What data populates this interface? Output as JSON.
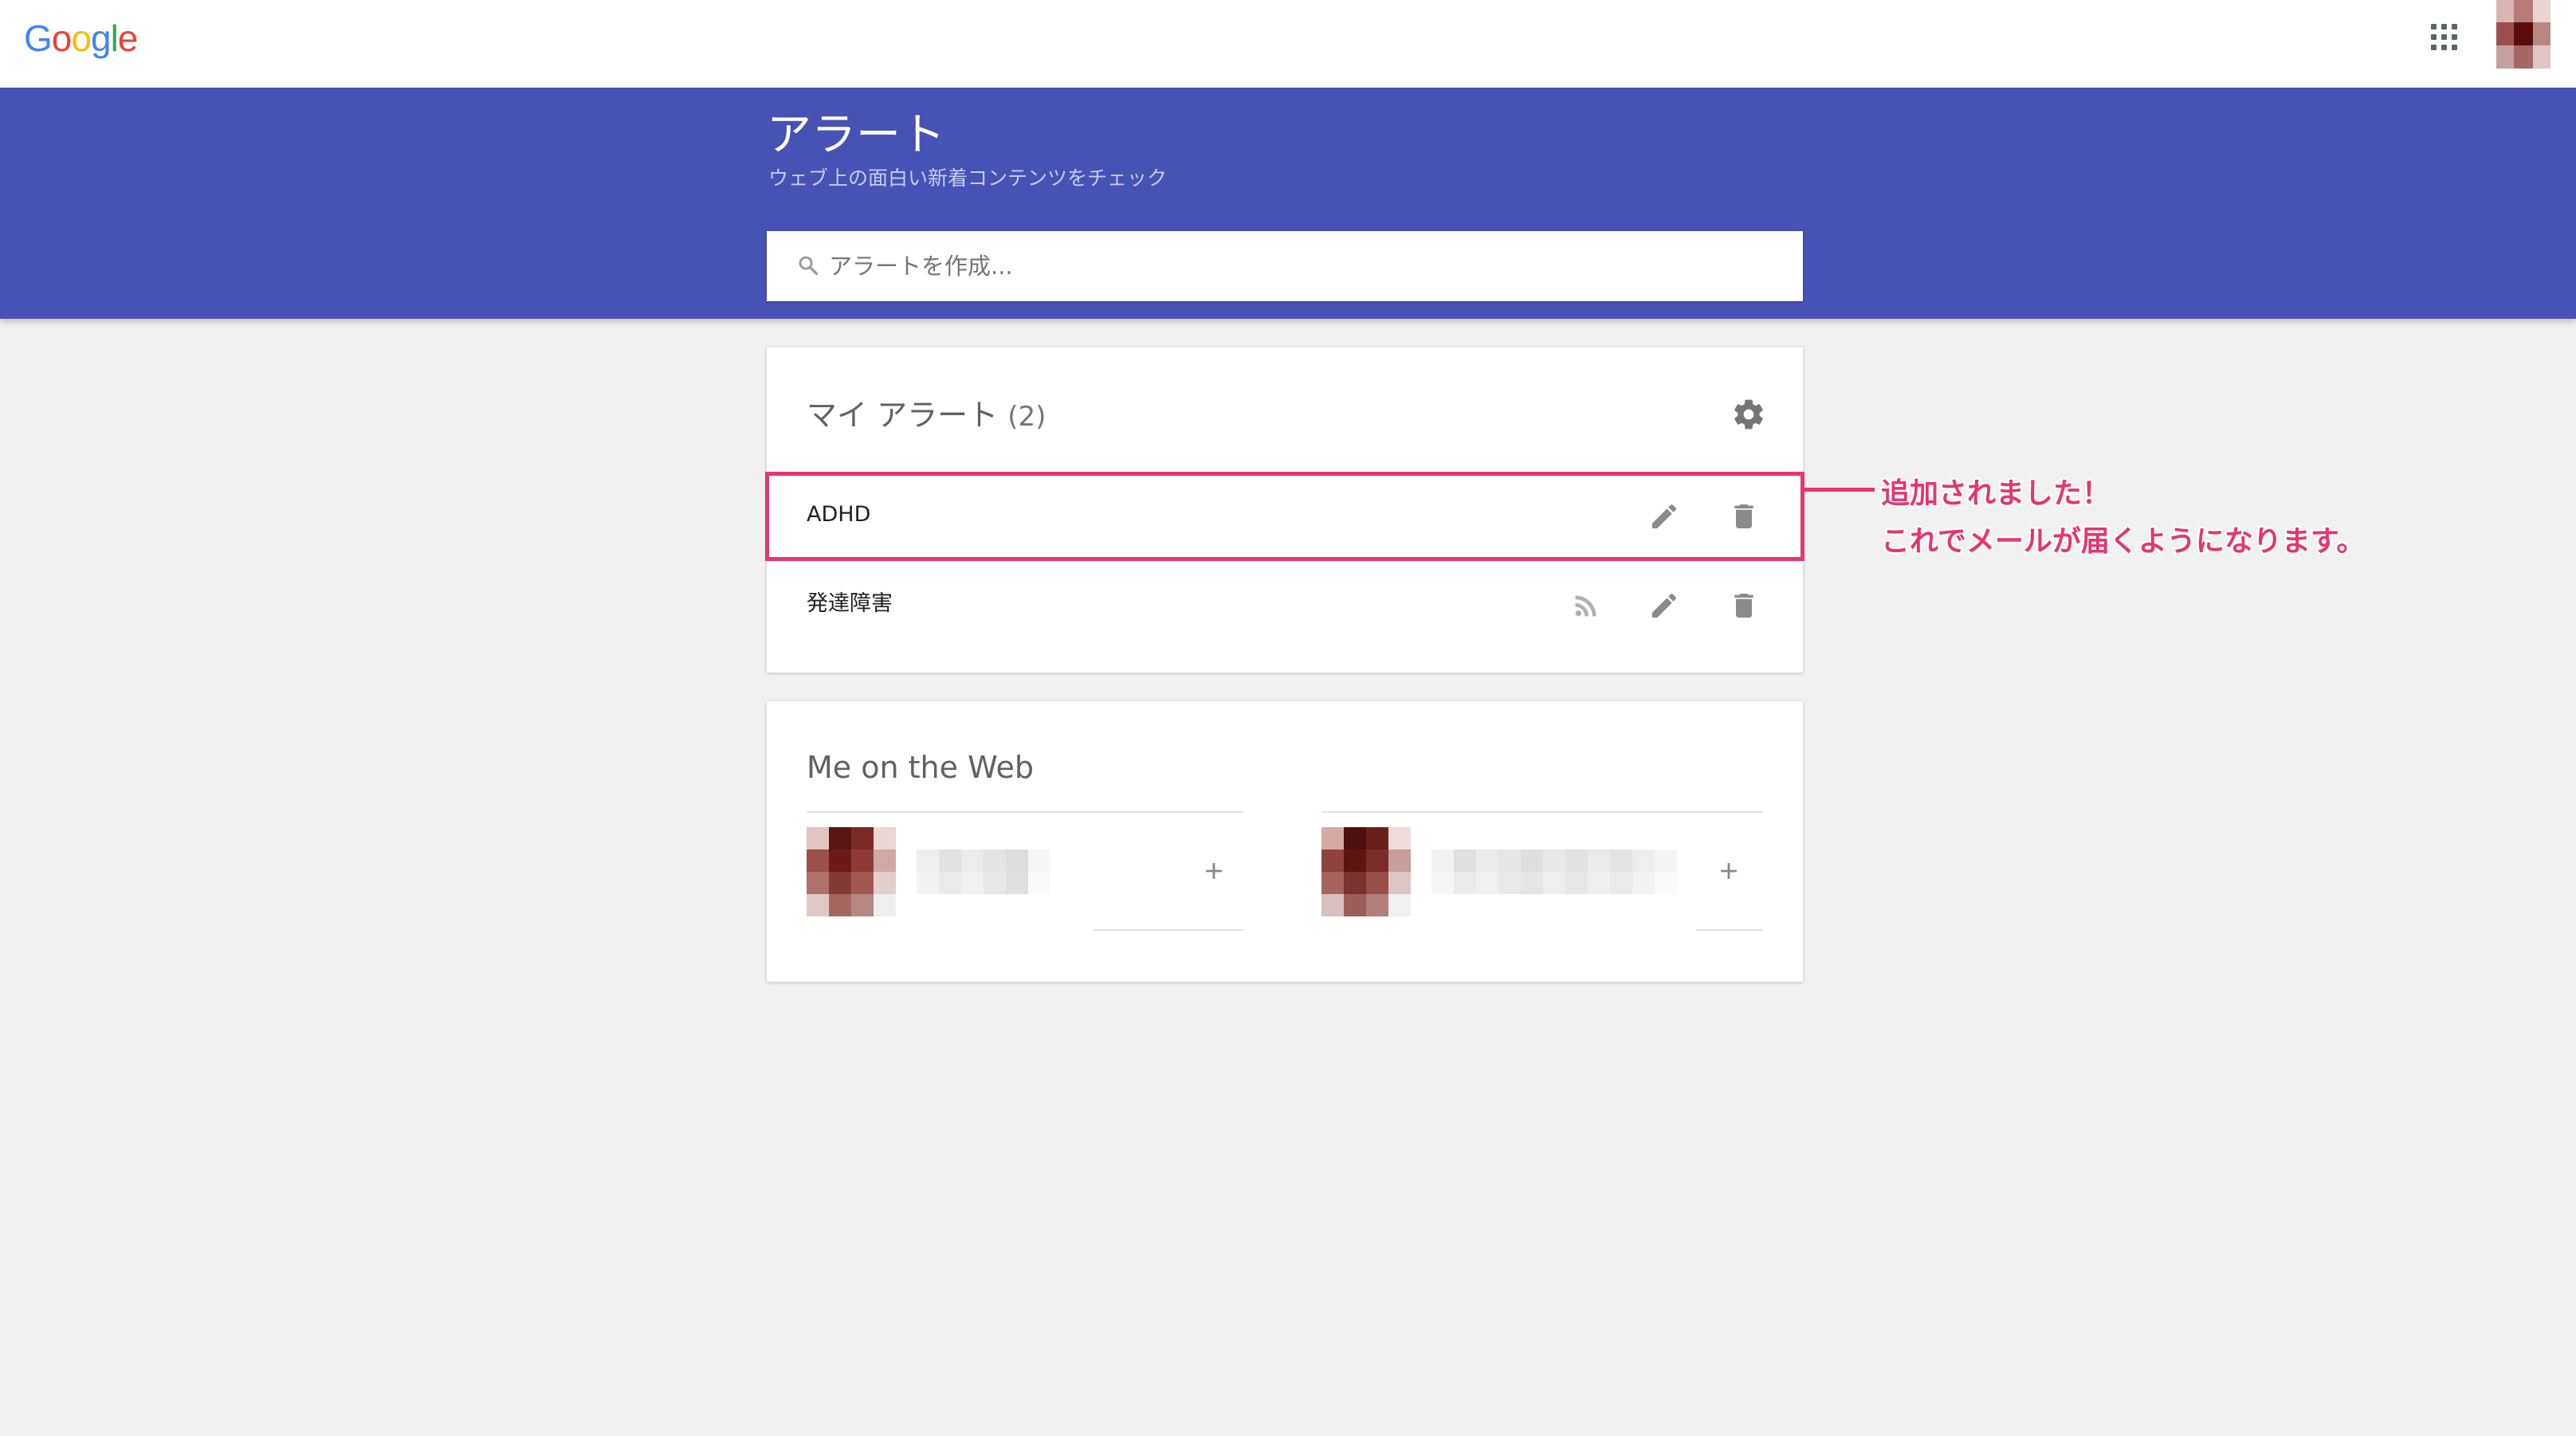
{
  "header": {
    "logo_letters": [
      {
        "char": "G",
        "color": "#4285F4"
      },
      {
        "char": "o",
        "color": "#EA4335"
      },
      {
        "char": "o",
        "color": "#FBBC05"
      },
      {
        "char": "g",
        "color": "#4285F4"
      },
      {
        "char": "l",
        "color": "#34A853"
      },
      {
        "char": "e",
        "color": "#EA4335"
      }
    ],
    "apps_icon": "apps-grid-icon",
    "avatar_icon": "account-avatar"
  },
  "banner": {
    "title": "アラート",
    "subtitle": "ウェブ上の面白い新着コンテンツをチェック",
    "background": "#4752b5"
  },
  "search": {
    "placeholder": "アラートを作成...",
    "value": "",
    "icon": "search-icon"
  },
  "my_alerts": {
    "title": "マイ アラート",
    "count": "(2)",
    "settings_icon": "gear-icon",
    "items": [
      {
        "label": "ADHD",
        "icons": [
          "pencil-icon",
          "trash-icon"
        ],
        "highlighted": true
      },
      {
        "label": "発達障害",
        "icons": [
          "rss-icon",
          "pencil-icon",
          "trash-icon"
        ],
        "highlighted": false
      }
    ]
  },
  "me_on_web": {
    "title": "Me on the Web",
    "profiles": [
      {
        "avatar": "pixelated-avatar",
        "name": "",
        "action_icon": "plus-icon"
      },
      {
        "avatar": "pixelated-avatar",
        "name": "",
        "action_icon": "plus-icon"
      }
    ]
  },
  "annotation": {
    "line1": "追加されました！",
    "line2": "これでメールが届くようになります。",
    "color": "#e5366f"
  }
}
